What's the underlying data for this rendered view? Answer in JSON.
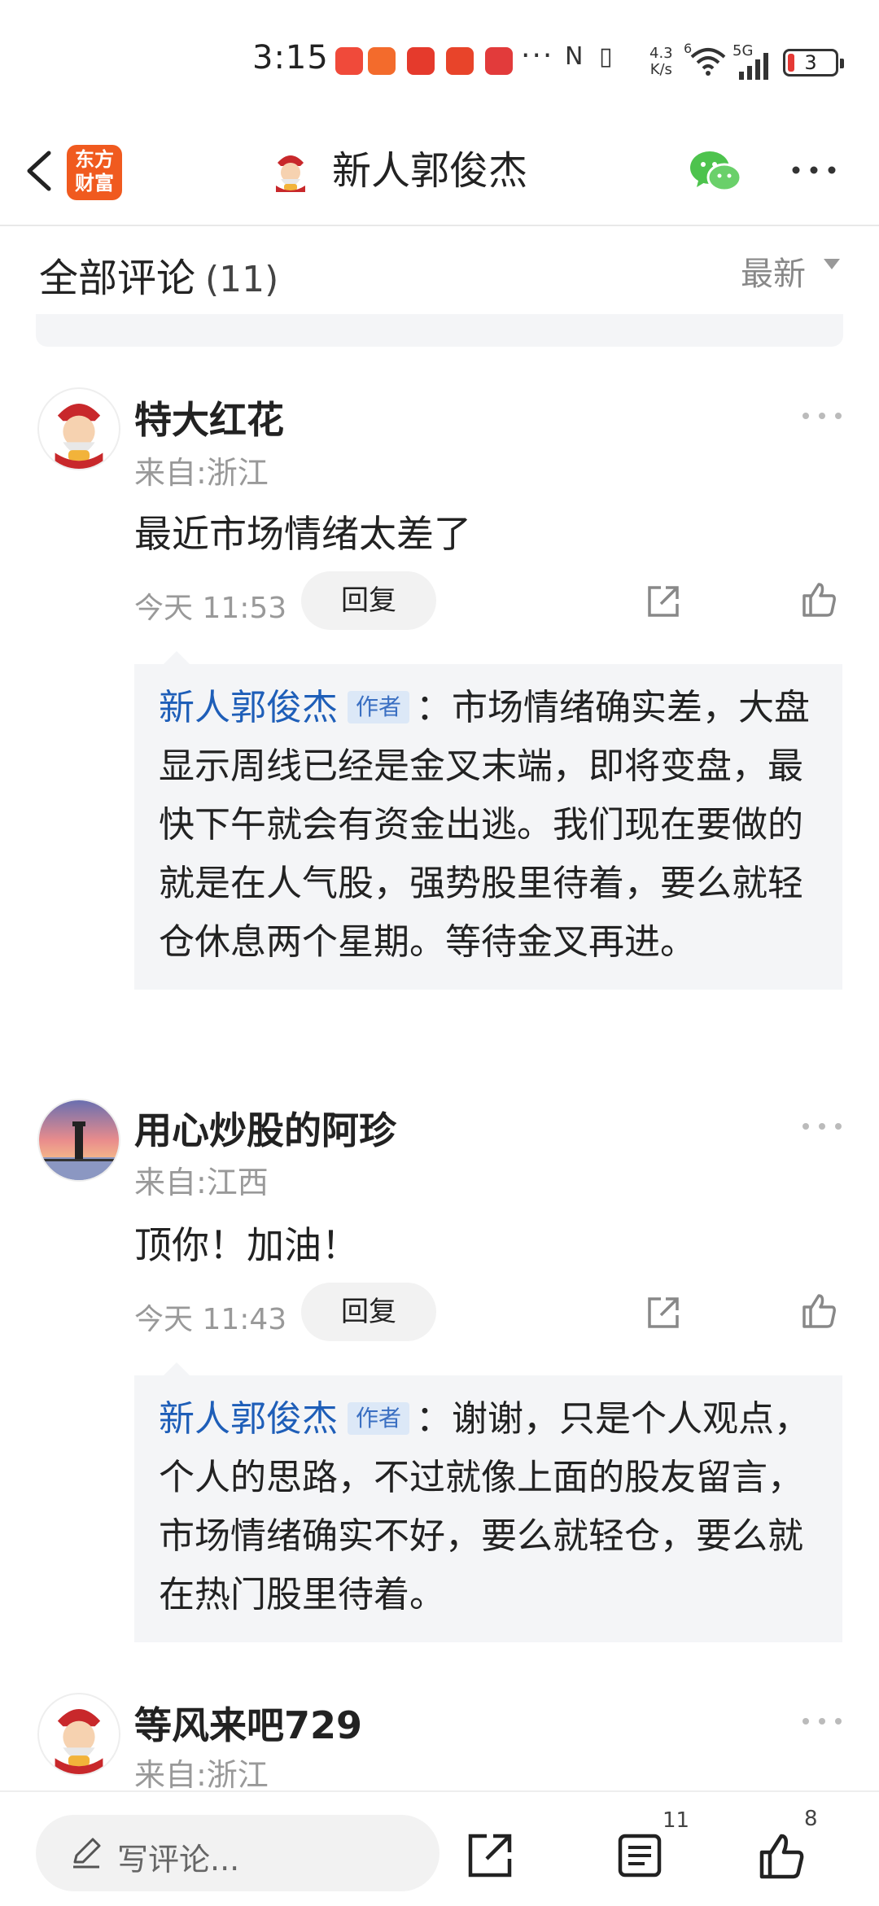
{
  "status_bar": {
    "time": "3:15",
    "network_speed_value": "4.3",
    "network_speed_unit": "K/s",
    "wifi_label": "6",
    "signal_label": "5G",
    "battery": "3"
  },
  "nav": {
    "logo_line1": "东方",
    "logo_line2": "财富",
    "title": "新人郭俊杰"
  },
  "comments_header": {
    "title": "全部评论",
    "count": "(11)",
    "sort_label": "最新"
  },
  "comments": [
    {
      "username": "特大红花",
      "location": "来自:浙江",
      "text": "最近市场情绪太差了",
      "time": "今天 11:53",
      "reply_label": "回复",
      "reply": {
        "name": "新人郭俊杰",
        "tag": "作者",
        "text": "：市场情绪确实差，大盘显示周线已经是金叉末端，即将变盘，最快下午就会有资金出逃。我们现在要做的就是在人气股，强势股里待着，要么就轻仓休息两个星期。等待金叉再进。"
      }
    },
    {
      "username": "用心炒股的阿珍",
      "location": "来自:江西",
      "text": "顶你！加油！",
      "time": "今天 11:43",
      "reply_label": "回复",
      "reply": {
        "name": "新人郭俊杰",
        "tag": "作者",
        "text": "：谢谢，只是个人观点，个人的思路，不过就像上面的股友留言，市场情绪确实不好，要么就轻仓，要么就在热门股里待着。"
      }
    },
    {
      "username": "等风来吧729",
      "location": "来自:浙江"
    }
  ],
  "bottom_bar": {
    "write_placeholder": "写评论...",
    "comment_count": "11",
    "like_count": "8"
  },
  "colors": {
    "brand_orange": "#f05a1f",
    "reply_name_blue": "#1e5eb8",
    "reply_bg": "#f4f5f7"
  }
}
